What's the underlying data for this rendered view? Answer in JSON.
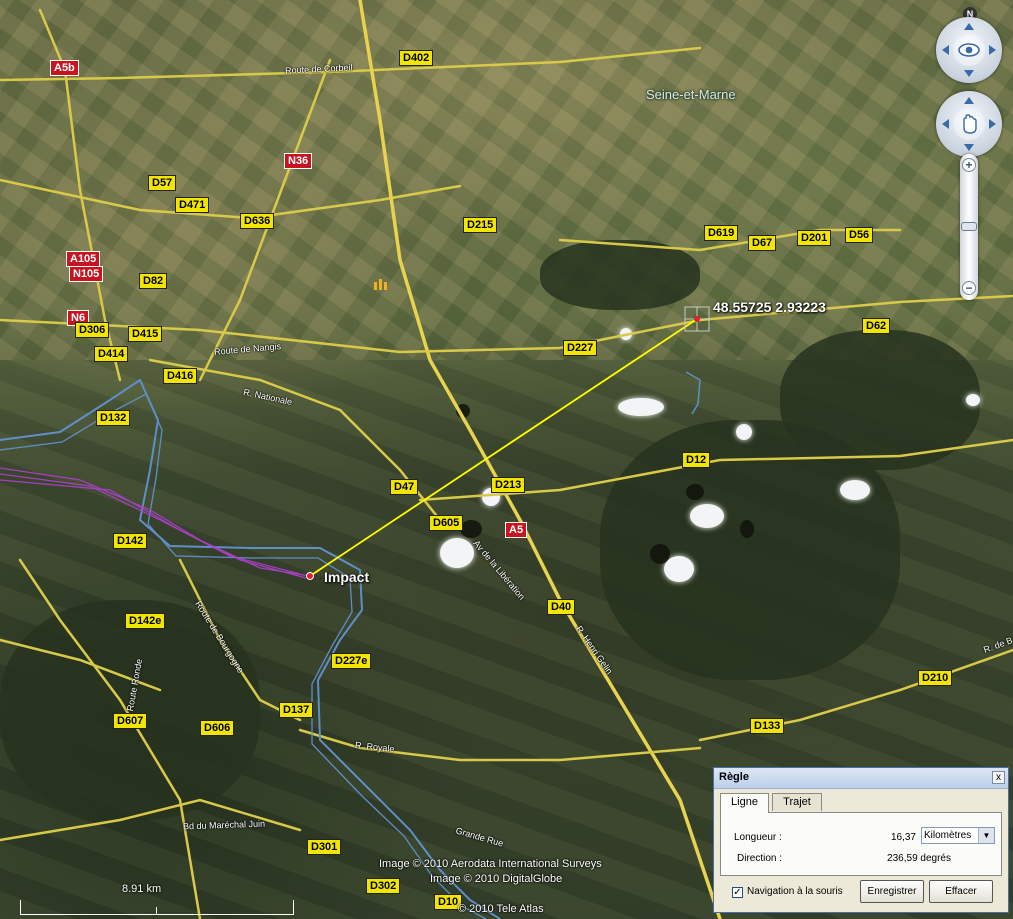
{
  "map": {
    "region_label": "Seine-et-Marne",
    "placemarks": {
      "impact": "Impact",
      "target": "48.55725 2.93223"
    },
    "road_shields": [
      {
        "id": "a5b",
        "text": "A5b",
        "kind": "red"
      },
      {
        "id": "d402",
        "text": "D402",
        "kind": "yellow"
      },
      {
        "id": "n36",
        "text": "N36",
        "kind": "red"
      },
      {
        "id": "d57",
        "text": "D57",
        "kind": "yellow"
      },
      {
        "id": "d471",
        "text": "D471",
        "kind": "yellow"
      },
      {
        "id": "d636",
        "text": "D636",
        "kind": "yellow"
      },
      {
        "id": "d215",
        "text": "D215",
        "kind": "yellow"
      },
      {
        "id": "d619",
        "text": "D619",
        "kind": "yellow"
      },
      {
        "id": "d67",
        "text": "D67",
        "kind": "yellow"
      },
      {
        "id": "d201",
        "text": "D201",
        "kind": "yellow"
      },
      {
        "id": "d56",
        "text": "D56",
        "kind": "yellow"
      },
      {
        "id": "a105",
        "text": "A105",
        "kind": "red"
      },
      {
        "id": "n105",
        "text": "N105",
        "kind": "red"
      },
      {
        "id": "d82",
        "text": "D82",
        "kind": "yellow"
      },
      {
        "id": "n6",
        "text": "N6",
        "kind": "red"
      },
      {
        "id": "d306",
        "text": "D306",
        "kind": "yellow"
      },
      {
        "id": "d415",
        "text": "D415",
        "kind": "yellow"
      },
      {
        "id": "d414",
        "text": "D414",
        "kind": "yellow"
      },
      {
        "id": "d416",
        "text": "D416",
        "kind": "yellow"
      },
      {
        "id": "d227",
        "text": "D227",
        "kind": "yellow"
      },
      {
        "id": "d62",
        "text": "D62",
        "kind": "yellow"
      },
      {
        "id": "d132",
        "text": "D132",
        "kind": "yellow"
      },
      {
        "id": "d12",
        "text": "D12",
        "kind": "yellow"
      },
      {
        "id": "d47",
        "text": "D47",
        "kind": "yellow"
      },
      {
        "id": "d213",
        "text": "D213",
        "kind": "yellow"
      },
      {
        "id": "d605",
        "text": "D605",
        "kind": "yellow"
      },
      {
        "id": "a5",
        "text": "A5",
        "kind": "red"
      },
      {
        "id": "d142",
        "text": "D142",
        "kind": "yellow"
      },
      {
        "id": "d142e",
        "text": "D142e",
        "kind": "yellow"
      },
      {
        "id": "d40",
        "text": "D40",
        "kind": "yellow"
      },
      {
        "id": "d227e",
        "text": "D227e",
        "kind": "yellow"
      },
      {
        "id": "d210",
        "text": "D210",
        "kind": "yellow"
      },
      {
        "id": "d607",
        "text": "D607",
        "kind": "yellow"
      },
      {
        "id": "d606",
        "text": "D606",
        "kind": "yellow"
      },
      {
        "id": "d137",
        "text": "D137",
        "kind": "yellow"
      },
      {
        "id": "d133",
        "text": "D133",
        "kind": "yellow"
      },
      {
        "id": "d301",
        "text": "D301",
        "kind": "yellow"
      },
      {
        "id": "d302",
        "text": "D302",
        "kind": "yellow"
      },
      {
        "id": "d10",
        "text": "D10",
        "kind": "yellow"
      }
    ],
    "street_labels": {
      "route_corbeil": "Route de Corbeil",
      "route_nangis": "Route de Nangis",
      "r_nationale": "R. Nationale",
      "av_liberation": "Av de la Libération",
      "r_henri_gelin": "R. Henri Gelin",
      "route_ronde": "Route Ronde",
      "route_bourgogne": "Route de Bourgogne",
      "r_royale": "R. Royale",
      "bd_marechal_juin": "Bd du Maréchal Juin",
      "grande_rue": "Grande Rue",
      "r_de_b": "R. de B"
    },
    "attribution": [
      "Image © 2010 Aerodata International Surveys",
      "Image © 2010 DigitalGlobe",
      "© 2010 Tele Atlas"
    ],
    "scale_label": "8.91  km"
  },
  "nav": {
    "north_letter": "N"
  },
  "ruler": {
    "title": "Règle",
    "close": "x",
    "tabs": [
      "Ligne",
      "Trajet"
    ],
    "length_label": "Longueur :",
    "length_value": "16,37",
    "unit_selected": "Kilomètres",
    "direction_label": "Direction :",
    "direction_value": "236,59 degrés",
    "mouse_nav_label": "Navigation à la souris",
    "mouse_nav_checked": true,
    "save_button": "Enregistrer",
    "clear_button": "Effacer"
  },
  "colors": {
    "road_yellow": "#f2e600",
    "road_red": "#c8141e",
    "ruler_line": "#ffff00",
    "river": "#5f8fc8",
    "track": "#b040d0"
  }
}
